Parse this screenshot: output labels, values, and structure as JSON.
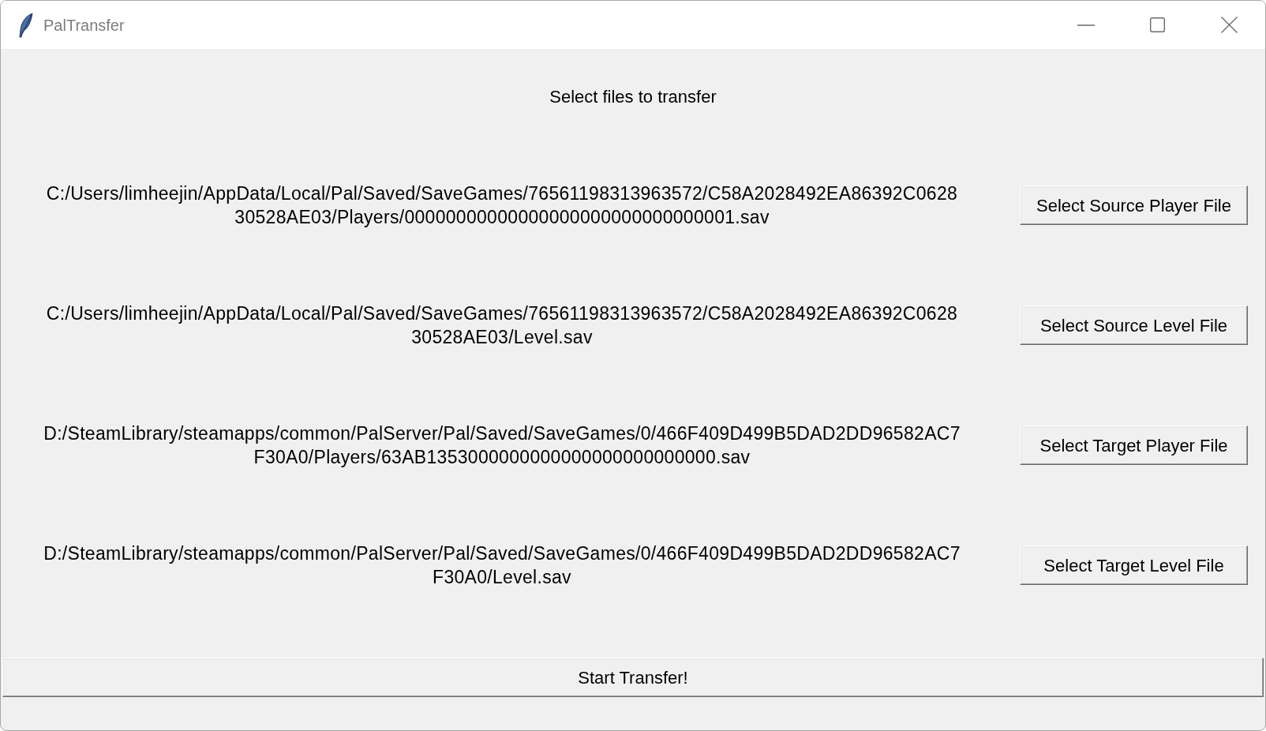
{
  "window": {
    "title": "PalTransfer"
  },
  "heading": "Select files to transfer",
  "file_rows": [
    {
      "path_lines": [
        "C:/Users/limheejin/AppData/Local/Pal/Saved/SaveGames/76561198313963572/C58A2028492EA86392C0628",
        "30528AE03/Players/00000000000000000000000000000001.sav"
      ],
      "button": "Select Source Player File"
    },
    {
      "path_lines": [
        "C:/Users/limheejin/AppData/Local/Pal/Saved/SaveGames/76561198313963572/C58A2028492EA86392C0628",
        "30528AE03/Level.sav"
      ],
      "button": "Select Source Level File"
    },
    {
      "path_lines": [
        "D:/SteamLibrary/steamapps/common/PalServer/Pal/Saved/SaveGames/0/466F409D499B5DAD2DD96582AC7",
        "F30A0/Players/63AB1353000000000000000000000000.sav"
      ],
      "button": "Select Target Player File"
    },
    {
      "path_lines": [
        "D:/SteamLibrary/steamapps/common/PalServer/Pal/Saved/SaveGames/0/466F409D499B5DAD2DD96582AC7",
        "F30A0/Level.sav"
      ],
      "button": "Select Target Level File"
    }
  ],
  "start_button": "Start Transfer!"
}
